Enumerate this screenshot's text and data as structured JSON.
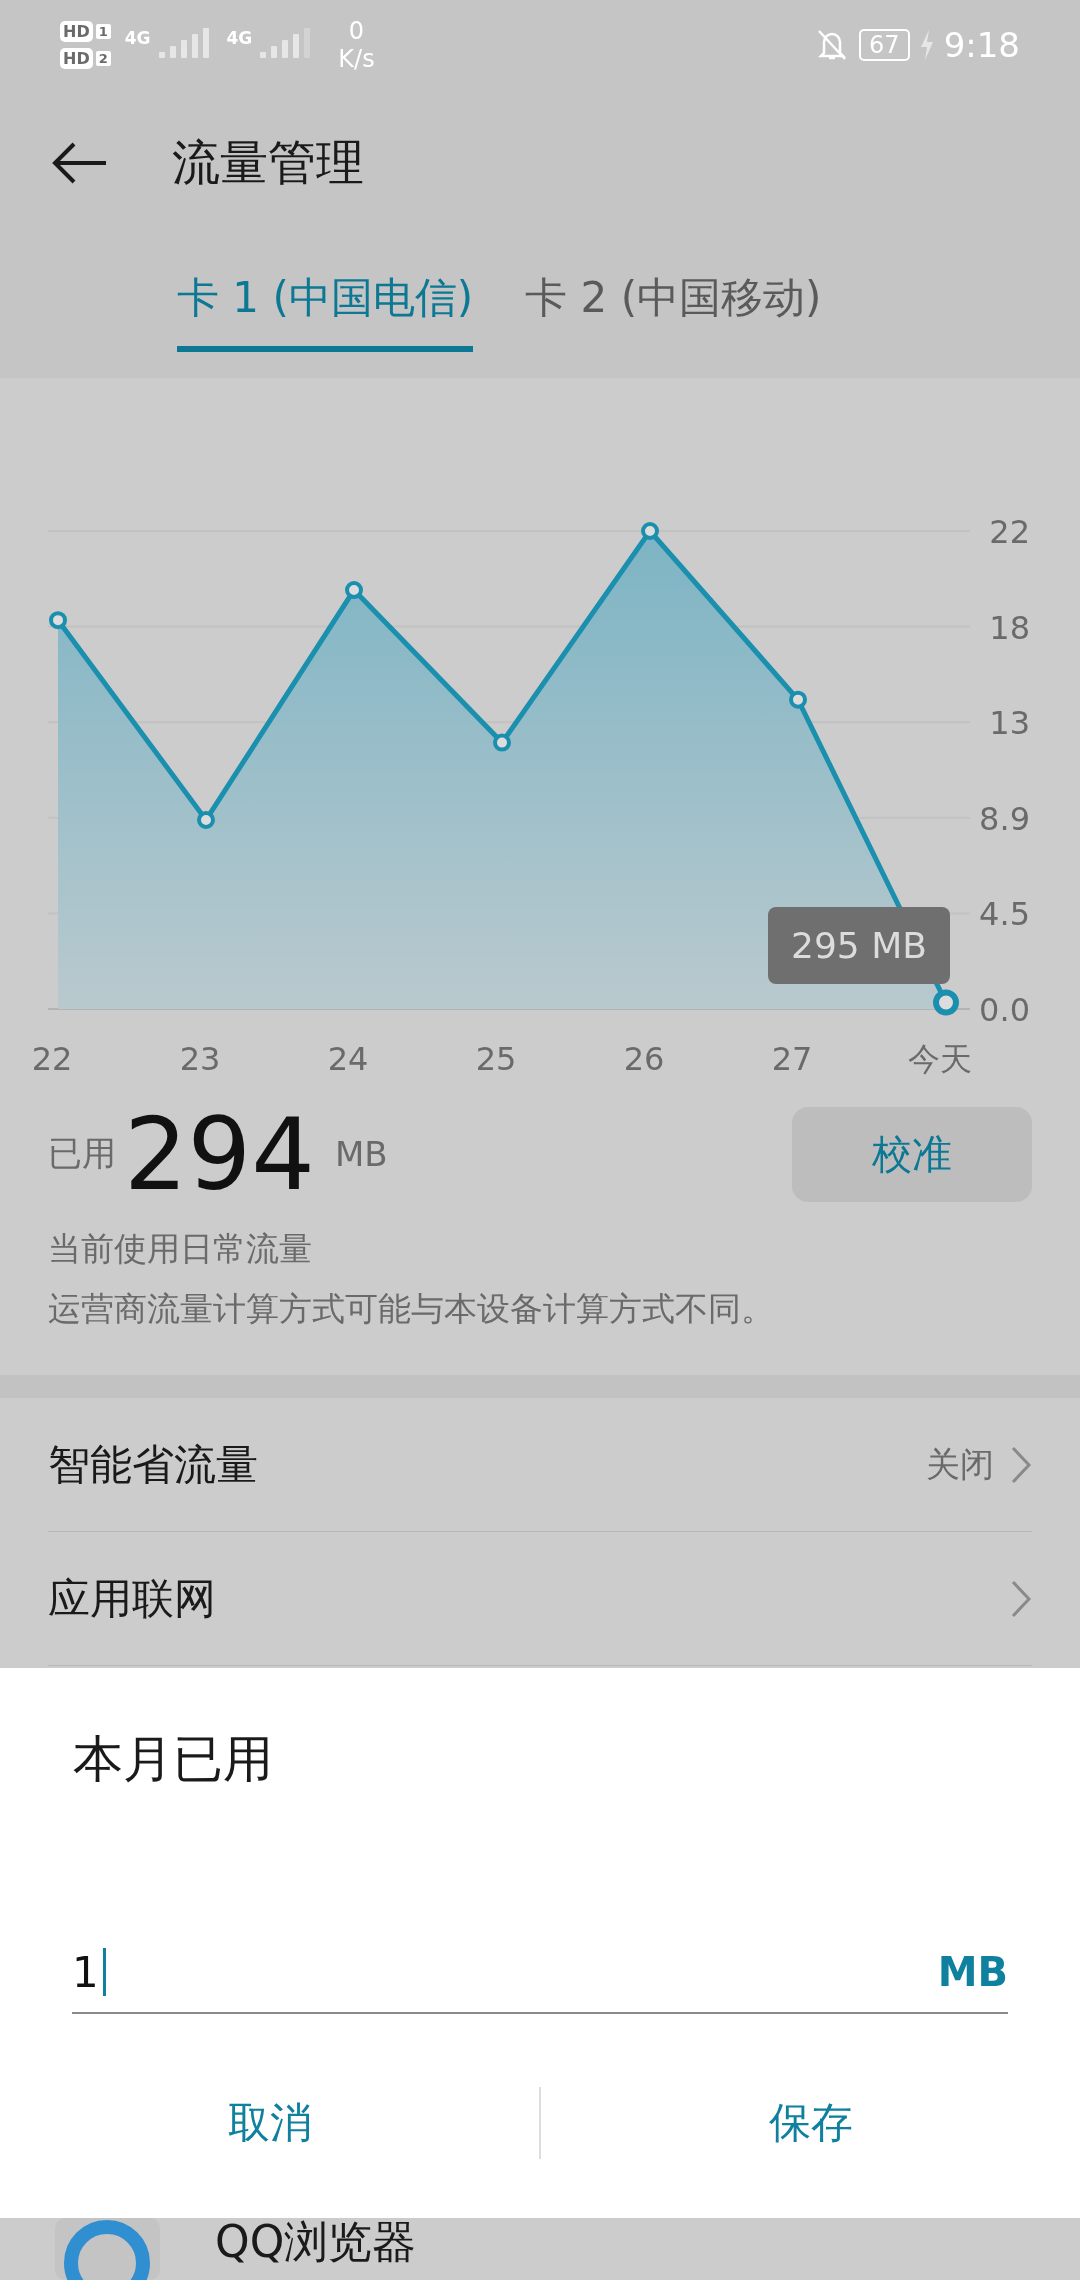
{
  "status_bar": {
    "sims": [
      {
        "badge": "HD",
        "slot": "1"
      },
      {
        "badge": "HD",
        "slot": "2"
      }
    ],
    "networks": [
      {
        "type": "4G"
      },
      {
        "type": "4G"
      }
    ],
    "speed": {
      "value": "0",
      "unit": "K/s"
    },
    "battery": "67",
    "time": "9:18"
  },
  "header": {
    "title": "流量管理"
  },
  "tabs": [
    {
      "label": "卡 1 (中国电信)",
      "selected": true
    },
    {
      "label": "卡 2 (中国移动)",
      "selected": false
    }
  ],
  "chart_data": {
    "type": "area",
    "categories": [
      "22",
      "23",
      "24",
      "25",
      "26",
      "27",
      "今天"
    ],
    "grid": true,
    "series": [
      {
        "color": "#1a8fae",
        "values": [
          18.1,
          8.8,
          19.5,
          12.4,
          22.25,
          14.4,
          0.3
        ]
      }
    ],
    "ylim": [
      0,
      22.25
    ],
    "yticks": [
      {
        "value": 0,
        "label": "0.0"
      },
      {
        "value": 4.45,
        "label": "4.5"
      },
      {
        "value": 8.9,
        "label": "8.9"
      },
      {
        "value": 13.35,
        "label": "13"
      },
      {
        "value": 17.8,
        "label": "18"
      },
      {
        "value": 22.25,
        "label": "22"
      }
    ],
    "annotations": [
      {
        "text": "295 MB"
      }
    ]
  },
  "usage": {
    "prefix": "已用",
    "amount": "294",
    "unit": "MB",
    "button": "校准",
    "notes": [
      "当前使用日常流量",
      "运营商流量计算方式可能与本设备计算方式不同。"
    ]
  },
  "settings": [
    {
      "label": "智能省流量",
      "value": "关闭"
    },
    {
      "label": "应用联网"
    }
  ],
  "dialog": {
    "title": "本月已用",
    "value": "1",
    "unit": "MB",
    "buttons": [
      "取消",
      "保存"
    ]
  },
  "apps": [
    {
      "name": "QQ浏览器"
    }
  ]
}
